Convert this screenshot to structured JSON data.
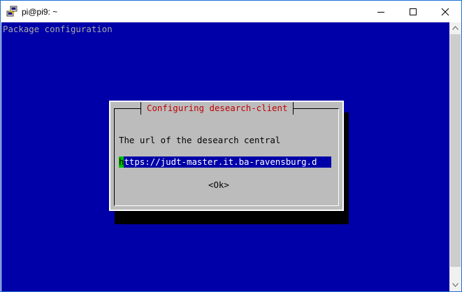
{
  "window": {
    "title": "pi@pi9: ~",
    "icon": "putty-icon"
  },
  "terminal": {
    "header": "Package configuration",
    "colors": {
      "background": "#0000a8",
      "dialog": "#bcbcbc",
      "title": "#c00000",
      "cursor": "#00c000"
    }
  },
  "dialog": {
    "title": "Configuring desearch-client",
    "prompt": "The url of the desearch central",
    "input_cursor_char": "h",
    "input_rest": "ttps://judt-master.it.ba-ravensburg.d",
    "ok_label": "<Ok>"
  }
}
